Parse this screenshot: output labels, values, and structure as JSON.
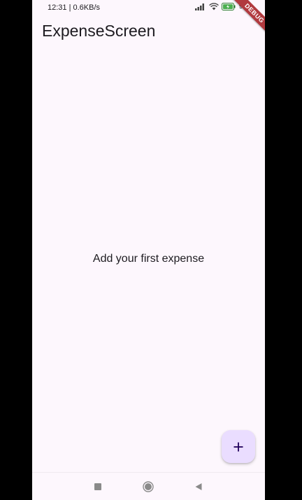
{
  "status_bar": {
    "time": "12:31 | 0.6KB/s",
    "battery": "95"
  },
  "debug_banner": "DEBUG",
  "app_bar": {
    "title": "ExpenseScreen"
  },
  "main": {
    "empty_message": "Add your first expense"
  },
  "fab": {
    "icon": "add-icon"
  },
  "colors": {
    "background": "#fdf7fd",
    "fab_background": "#eaddff",
    "fab_icon": "#21005d",
    "debug_banner": "#b13a3f",
    "text": "#1d1b20"
  }
}
